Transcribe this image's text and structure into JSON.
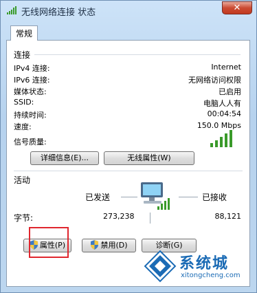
{
  "window": {
    "title": "无线网络连接 状态",
    "close_label": "✕"
  },
  "tabs": [
    {
      "label": "常规"
    }
  ],
  "connection": {
    "heading": "连接",
    "rows": [
      {
        "label": "IPv4 连接:",
        "value": "Internet"
      },
      {
        "label": "IPv6 连接:",
        "value": "无网络访问权限"
      },
      {
        "label": "媒体状态:",
        "value": "已启用"
      },
      {
        "label": "SSID:",
        "value": "电脑人人有"
      },
      {
        "label": "持续时间:",
        "value": "00:04:54"
      },
      {
        "label": "速度:",
        "value": "150.0 Mbps"
      }
    ],
    "signal_label": "信号质量:",
    "signal_bars": 5,
    "details_button": "详细信息(E)...",
    "wireless_props_button": "无线属性(W)"
  },
  "activity": {
    "heading": "活动",
    "sent_label": "已发送",
    "received_label": "已接收",
    "bytes_label": "字节:",
    "sent_value": "273,238",
    "received_value": "88,121"
  },
  "buttons": {
    "properties": "属性(P)",
    "disable": "禁用(D)",
    "diagnose": "诊断(G)"
  },
  "watermark": {
    "text": "系统城",
    "url": "xitongcheng.com"
  },
  "colors": {
    "accent": "#1b6bb5",
    "signal": "#3a9a2a",
    "highlight": "#e0262e"
  }
}
